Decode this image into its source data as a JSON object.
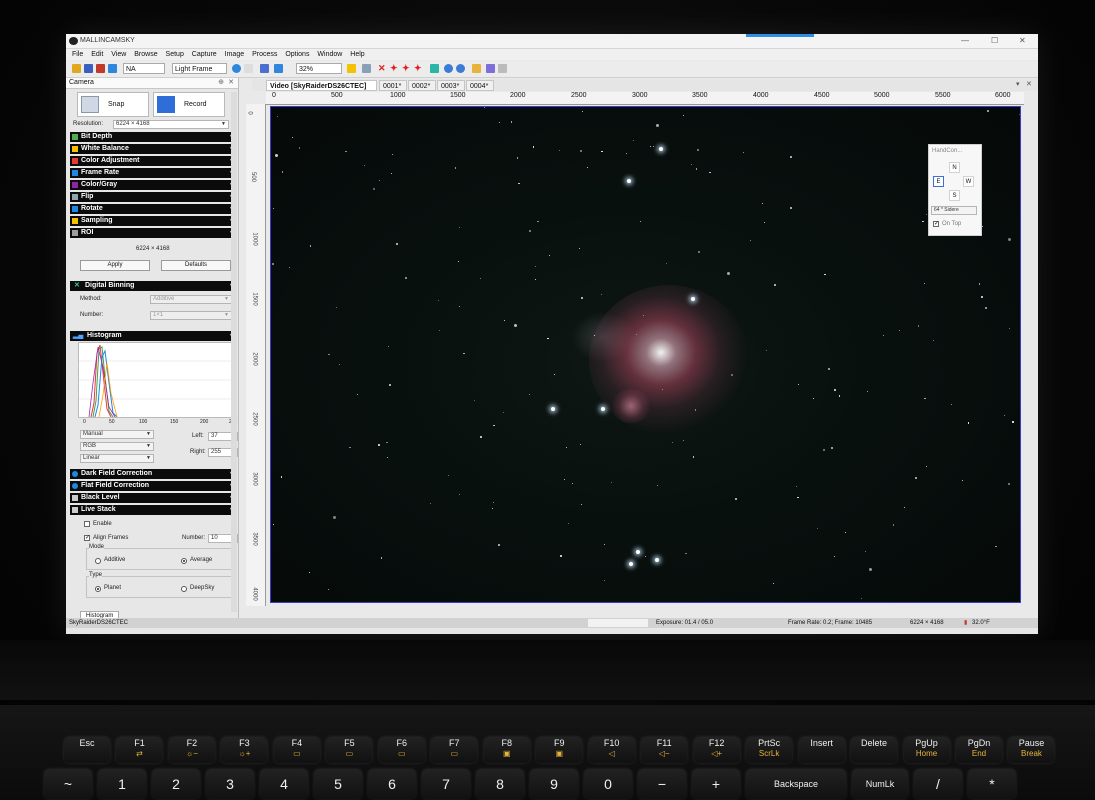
{
  "window": {
    "title": "MALLINCAMSKY",
    "min": "—",
    "max": "☐",
    "close": "✕"
  },
  "menu": [
    "File",
    "Edit",
    "View",
    "Browse",
    "Setup",
    "Capture",
    "Image",
    "Process",
    "Options",
    "Window",
    "Help"
  ],
  "toolbar": {
    "format_value": "NA",
    "frame_type": "Light Frame",
    "zoom": "32%"
  },
  "panel": {
    "title": "Camera",
    "snap": "Snap",
    "record": "Record",
    "resolution_label": "Resolution:",
    "resolution_value": "6224 × 4168",
    "sections": [
      {
        "label": "Bit Depth",
        "color": "#4caf50"
      },
      {
        "label": "White Balance",
        "color": "#f2c200"
      },
      {
        "label": "Color Adjustment",
        "color": "#e53935"
      },
      {
        "label": "Frame Rate",
        "color": "#1e88e5"
      },
      {
        "label": "Color/Gray",
        "color": "#8e24aa"
      },
      {
        "label": "Flip",
        "color": "#90a4ae"
      },
      {
        "label": "Rotate",
        "color": "#1e88e5"
      },
      {
        "label": "Sampling",
        "color": "#f2c200"
      },
      {
        "label": "ROI",
        "color": "#9e9e9e"
      }
    ],
    "roi_size": "6224  ×  4168",
    "apply": "Apply",
    "defaults": "Defaults",
    "binning": {
      "title": "Digital Binning",
      "method_label": "Method:",
      "method_value": "Additive",
      "number_label": "Number:",
      "number_value": "1×1"
    },
    "histogram": {
      "title": "Histogram",
      "ticks": [
        "0",
        "50",
        "100",
        "150",
        "200",
        "255"
      ],
      "mode": "Manual",
      "channel": "RGB",
      "scale": "Linear",
      "left_label": "Left:",
      "left_value": "37",
      "right_label": "Right:",
      "right_value": "255"
    },
    "sections2": [
      {
        "label": "Dark Field Correction",
        "color": "#1e88e5"
      },
      {
        "label": "Flat Field Correction",
        "color": "#1e88e5"
      },
      {
        "label": "Black Level",
        "color": "#cccccc"
      },
      {
        "label": "Live Stack",
        "color": "#cccccc"
      }
    ],
    "live_stack": {
      "enable": "Enable",
      "align": "Align Frames",
      "number_label": "Number:",
      "number_value": "10",
      "mode_title": "Mode",
      "additive": "Additive",
      "average": "Average",
      "type_title": "Type",
      "planet": "Planet",
      "deepsky": "DeepSky"
    },
    "bottom_tab": "Histogram"
  },
  "tabs": [
    "Video [SkyRaiderDS26CTEC]",
    "0001*",
    "0002*",
    "0003*",
    "0004*"
  ],
  "ruler_top": [
    "0",
    "500",
    "1000",
    "1500",
    "2000",
    "2500",
    "3000",
    "3500",
    "4000",
    "4500",
    "5000",
    "5500",
    "6000"
  ],
  "ruler_left": [
    "0",
    "500",
    "1000",
    "1500",
    "2000",
    "2500",
    "3000",
    "3500",
    "4000"
  ],
  "hand_controller": {
    "title": "HandCon...",
    "n": "N",
    "e": "E",
    "w": "W",
    "s": "S",
    "speed": "64 * Sidere",
    "on_top": "On Top"
  },
  "status": {
    "camera": "SkyRaiderDS26CTEC",
    "exposure": "Exposure: 01.4 / 05.0",
    "frame_rate": "Frame Rate: 0.2; Frame: 10485",
    "resolution": "6224 × 4168",
    "temperature": "32.0°F"
  },
  "keyboard": {
    "fn_row": [
      {
        "main": "Esc",
        "sub": ""
      },
      {
        "main": "F1",
        "sub": "⇄"
      },
      {
        "main": "F2",
        "sub": "☼−"
      },
      {
        "main": "F3",
        "sub": "☼+"
      },
      {
        "main": "F4",
        "sub": "▭"
      },
      {
        "main": "F5",
        "sub": "▭"
      },
      {
        "main": "F6",
        "sub": "▭"
      },
      {
        "main": "F7",
        "sub": "▭"
      },
      {
        "main": "F8",
        "sub": "▣"
      },
      {
        "main": "F9",
        "sub": "▣"
      },
      {
        "main": "F10",
        "sub": "◁"
      },
      {
        "main": "F11",
        "sub": "◁−"
      },
      {
        "main": "F12",
        "sub": "◁+"
      },
      {
        "main": "PrtSc",
        "sub": "ScrLk"
      },
      {
        "main": "Insert",
        "sub": ""
      },
      {
        "main": "Delete",
        "sub": ""
      },
      {
        "main": "PgUp",
        "sub": "Home"
      },
      {
        "main": "PgDn",
        "sub": "End"
      },
      {
        "main": "Pause",
        "sub": "Break"
      }
    ],
    "num_row": [
      "~",
      "1",
      "2",
      "3",
      "4",
      "5",
      "6",
      "7",
      "8",
      "9",
      "0",
      "−",
      "+",
      "Backspace",
      "NumLk",
      "/",
      "*"
    ]
  }
}
